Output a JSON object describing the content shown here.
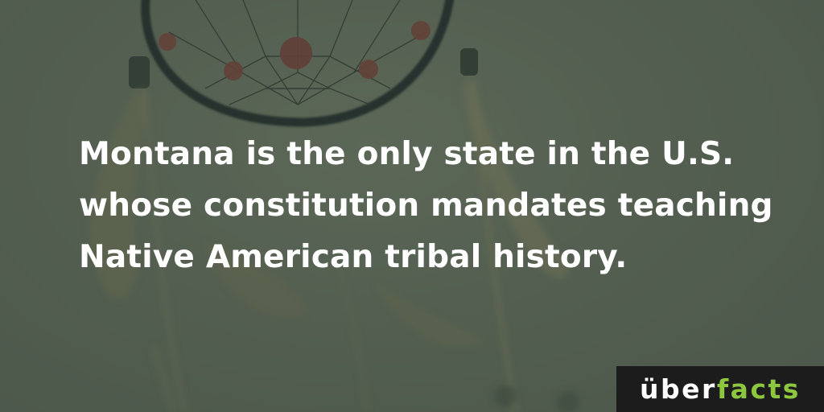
{
  "fact": {
    "lines": [
      "Montana is the only state in the U.S.",
      "whose constitution mandates teaching",
      "Native American tribal history."
    ]
  },
  "brand": {
    "part1": "über",
    "part2": "facts",
    "accent_color": "#8dc63f",
    "box_color": "#1c1c1c"
  },
  "background": {
    "subject": "dreamcatcher with feathers and beads",
    "tint_color": "#556052"
  }
}
